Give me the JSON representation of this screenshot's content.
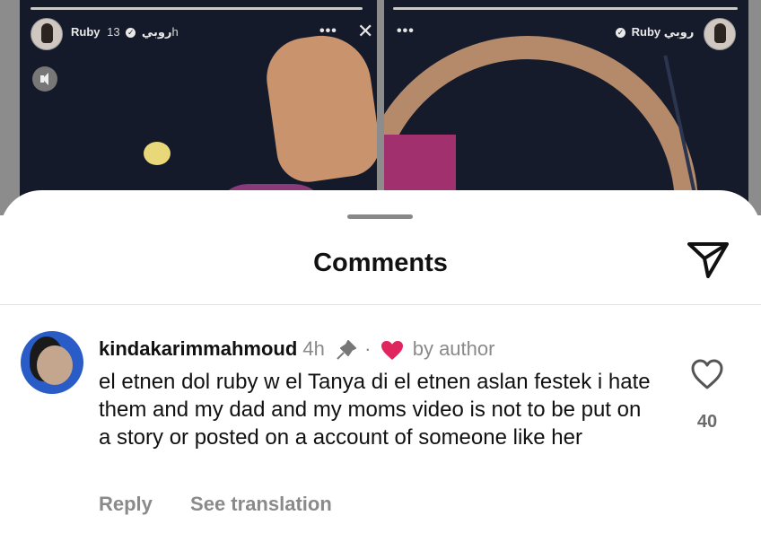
{
  "stories": {
    "left": {
      "username": "Ruby",
      "arabic_name": "روبي",
      "time": "13h"
    },
    "right": {
      "username": "Ruby",
      "arabic_name": "روبي"
    }
  },
  "sheet": {
    "title": "Comments"
  },
  "comment": {
    "username": "kindakarimmahmoud",
    "time": "4h",
    "separator": "·",
    "liked_by": "by author",
    "text": "el etnen dol ruby w el Tanya di el etnen aslan festek i hate them and my dad and my moms video is not to be put on a story or posted on a account of someone like her",
    "like_count": "40",
    "reply_label": "Reply",
    "translate_label": "See translation"
  },
  "icons": {
    "send": "send-icon",
    "pin": "pin-icon",
    "heart_filled": "heart-filled-icon",
    "heart_outline": "heart-outline-icon",
    "close": "close-icon",
    "more": "more-icon",
    "mute": "speaker-icon"
  },
  "colors": {
    "heart_red": "#e0245e",
    "text": "#111111",
    "muted": "#8a8a8a"
  }
}
